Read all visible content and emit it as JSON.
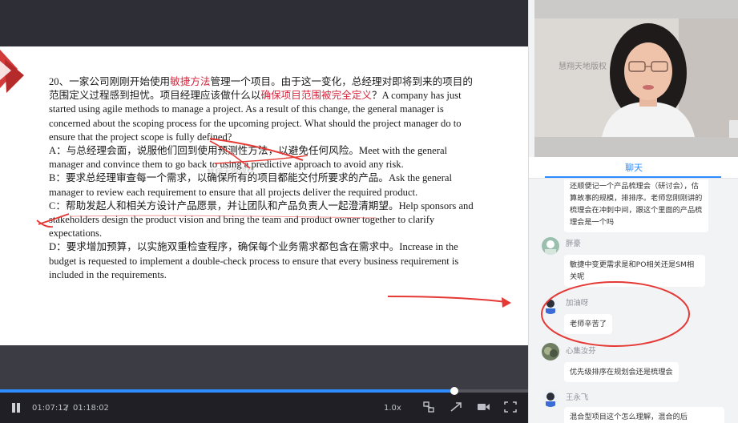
{
  "slide": {
    "q_line1_pre": "20、一家公司刚刚开始使用",
    "q_hl1": "敏捷方法",
    "q_line1_mid": "管理一个项目。由于这一变化，总经理对即将到来的项目的范围定义过程感到担忧。项目经理应该做什么以",
    "q_hl2": "确保项目范围被完全定义",
    "q_line1_post": "？A company has just started using agile methods to manage a project. As a result of this change, the general manager is concerned about the scoping process for the upcoming project. What should the project manager do to ensure that the project scope is fully defined?",
    "option_a": "A：与总经理会面，说服他们回到使用预测性方法，以避免任何风险。Meet with the general manager and convince them to go back to using a predictive approach to avoid any risk.",
    "option_b": "B：要求总经理审查每一个需求，以确保所有的项目都能交付所要求的产品。Ask the general manager to review each requirement to ensure that all projects deliver the required product.",
    "option_c": "C：帮助发起人和相关方设计产品愿景，并让团队和产品负责人一起澄清期望。Help sponsors and stakeholders design the product vision and bring the team and product owner together to clarify expectations.",
    "option_d": "D：要求增加预算，以实施双重检查程序，确保每个业务需求都包含在需求中。Increase in the budget is requested to implement a double-check process to ensure that every business requirement is included in the requirements.",
    "watermark": "慧翔天地版权"
  },
  "player": {
    "current_time": "01:07:12",
    "separator": "/",
    "total_time": "01:18:02",
    "speed": "1.0x",
    "progress": 0.86,
    "icons": [
      "pause-icon",
      "stepper-icon",
      "camera-icon",
      "expand-icon",
      "fullscreen-icon"
    ]
  },
  "camera": {
    "watermark": "慧翔天地版权"
  },
  "chat": {
    "tab_label": "聊天",
    "messages": [
      {
        "user": "",
        "text": "还顺便记一个产品梳理会（研讨会），估算故事的规模，排排序。老师您刚刚讲的梳理会在冲刺中间，跟这个里面的产品梳理会是一个吗"
      },
      {
        "user": "胖豪",
        "text": "敏捷中变更需求是和PO相关还是SM相关呢"
      },
      {
        "user": "加油呀",
        "text": "老师辛苦了"
      },
      {
        "user": "心集汝芬",
        "text": "优先级排序在规划会还是梳理会"
      },
      {
        "user": "王永飞",
        "text": "混合型项目这个怎么理解，混合的后"
      }
    ]
  },
  "colors": {
    "accent": "#2f8cff",
    "highlight": "#d7263d",
    "annotation": "#e53935"
  }
}
